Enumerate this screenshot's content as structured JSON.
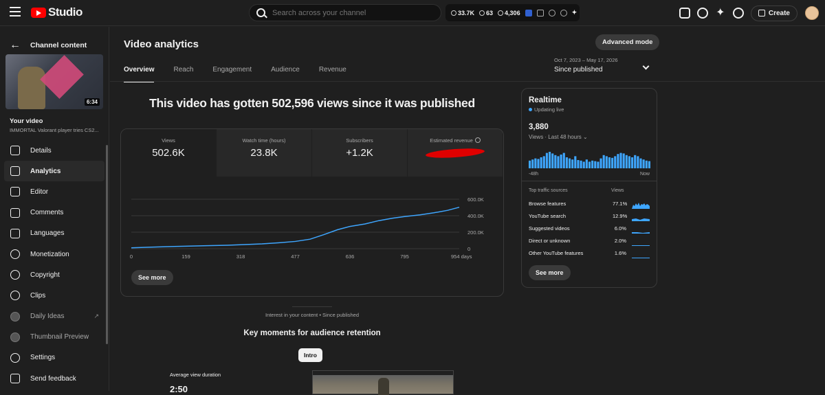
{
  "topbar": {
    "logo_text": "Studio",
    "search_placeholder": "Search across your channel",
    "stats": [
      {
        "icon": "clock-icon",
        "value": "33.7K"
      },
      {
        "icon": "eye-icon",
        "value": "63"
      },
      {
        "icon": "person-icon",
        "value": "4,306"
      }
    ],
    "create_label": "Create"
  },
  "sidebar": {
    "back_label": "Channel content",
    "thumb_duration": "6:34",
    "your_video": "Your video",
    "video_title": "IMMORTAL Valorant player tries CS2...",
    "items": [
      {
        "label": "Details",
        "icon": "pencil-icon"
      },
      {
        "label": "Analytics",
        "icon": "bar-chart-icon"
      },
      {
        "label": "Editor",
        "icon": "film-icon"
      },
      {
        "label": "Comments",
        "icon": "comment-icon"
      },
      {
        "label": "Languages",
        "icon": "subtitles-icon"
      },
      {
        "label": "Monetization",
        "icon": "dollar-icon"
      },
      {
        "label": "Copyright",
        "icon": "copyright-icon"
      },
      {
        "label": "Clips",
        "icon": "scissors-icon"
      },
      {
        "label": "Daily Ideas",
        "icon": "extension-icon"
      },
      {
        "label": "Thumbnail Preview",
        "icon": "extension-icon"
      },
      {
        "label": "Settings",
        "icon": "gear-icon"
      },
      {
        "label": "Send feedback",
        "icon": "feedback-icon"
      }
    ]
  },
  "main": {
    "title": "Video analytics",
    "advanced_mode": "Advanced mode",
    "tabs": [
      "Overview",
      "Reach",
      "Engagement",
      "Audience",
      "Revenue"
    ],
    "date_range": "Oct 7, 2023 – May 17, 2026",
    "date_label": "Since published",
    "headline": "This video has gotten 502,596 views since it was published",
    "metrics": [
      {
        "label": "Views",
        "value": "502.6K"
      },
      {
        "label": "Watch time (hours)",
        "value": "23.8K"
      },
      {
        "label": "Subscribers",
        "value": "+1.2K"
      },
      {
        "label": "Estimated revenue",
        "value": ""
      }
    ],
    "see_more": "See more",
    "interest": "Interest in your content • Since published",
    "key_moments": "Key moments for audience retention",
    "intro_chip": "Intro",
    "avg_view_label": "Average view duration",
    "avg_view_value": "2:50"
  },
  "chart_data": {
    "type": "line",
    "title": "",
    "xlabel": "",
    "ylabel": "",
    "x_ticks": [
      "0",
      "159",
      "318",
      "477",
      "636",
      "795",
      "954 days"
    ],
    "y_ticks": [
      "0",
      "200.0K",
      "400.0K",
      "600.0K"
    ],
    "ylim": [
      0,
      600000
    ],
    "xlim": [
      0,
      954
    ],
    "series": [
      {
        "x": [
          0,
          50,
          100,
          159,
          220,
          280,
          318,
          380,
          430,
          477,
          520,
          560,
          600,
          636,
          680,
          720,
          760,
          795,
          840,
          880,
          920,
          954
        ],
        "y": [
          10000,
          18000,
          24000,
          30000,
          36000,
          42000,
          48000,
          58000,
          72000,
          88000,
          115000,
          170000,
          230000,
          270000,
          300000,
          340000,
          370000,
          390000,
          410000,
          435000,
          465000,
          502596
        ]
      }
    ],
    "color": "#3ea6ff"
  },
  "realtime": {
    "title": "Realtime",
    "live": "Updating live",
    "value": "3,880",
    "views_label": "Views · Last 48 hours",
    "x_start": "-48h",
    "x_end": "Now",
    "bars": [
      14,
      16,
      18,
      17,
      20,
      22,
      28,
      30,
      27,
      24,
      22,
      25,
      28,
      20,
      18,
      16,
      22,
      15,
      14,
      12,
      16,
      12,
      14,
      13,
      12,
      18,
      24,
      22,
      20,
      19,
      22,
      26,
      28,
      27,
      24,
      22,
      20,
      24,
      22,
      18,
      16,
      14,
      13
    ],
    "traffic_header": "Top traffic sources",
    "traffic_header_right": "Views",
    "sources": [
      {
        "label": "Browse features",
        "pct": "77.1%"
      },
      {
        "label": "YouTube search",
        "pct": "12.9%"
      },
      {
        "label": "Suggested videos",
        "pct": "6.0%"
      },
      {
        "label": "Direct or unknown",
        "pct": "2.0%"
      },
      {
        "label": "Other YouTube features",
        "pct": "1.6%"
      }
    ],
    "see_more": "See more"
  }
}
